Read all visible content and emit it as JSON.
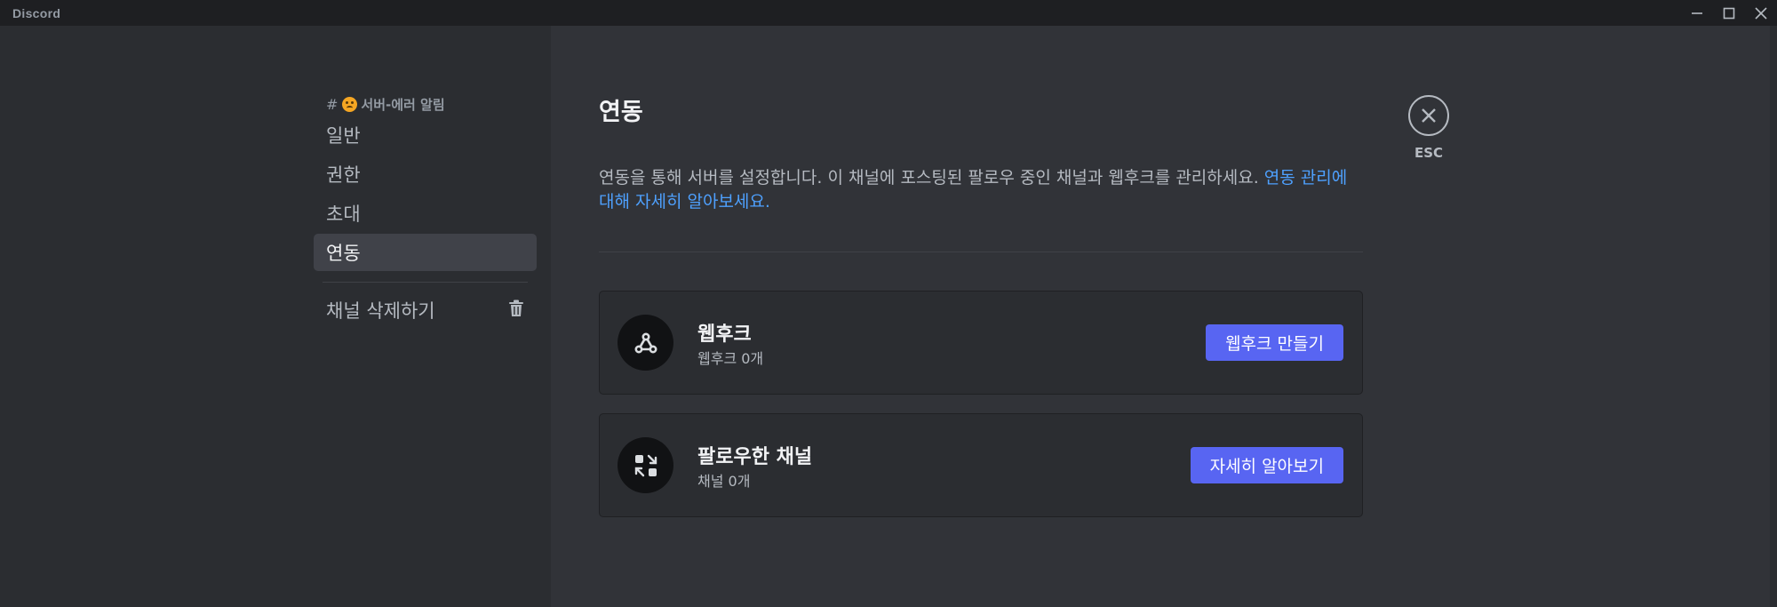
{
  "window": {
    "title": "Discord",
    "controls": [
      "minimize-icon",
      "maximize-icon",
      "close-icon"
    ]
  },
  "sidebar": {
    "channel_header": "서버-에러 알림",
    "channel_prefix": "#",
    "channel_emoji": "face-emoji-icon",
    "items": [
      {
        "label": "일반",
        "selected": false
      },
      {
        "label": "권한",
        "selected": false
      },
      {
        "label": "초대",
        "selected": false
      },
      {
        "label": "연동",
        "selected": true
      }
    ],
    "delete_label": "채널 삭제하기",
    "delete_icon": "trash-icon"
  },
  "main": {
    "title": "연동",
    "description": "연동을 통해 서버를 설정합니다. 이 채널에 포스팅된 팔로우 중인 채널과 웹후크를 관리하세요. ",
    "description_link": "연동 관리에 대해 자세히 알아보세요.",
    "cards": [
      {
        "icon": "webhook-icon",
        "title": "웹후크",
        "subtitle": "웹후크 0개",
        "button": "웹후크 만들기"
      },
      {
        "icon": "followed-channel-icon",
        "title": "팔로우한 채널",
        "subtitle": "채널 0개",
        "button": "자세히 알아보기"
      }
    ]
  },
  "esc": {
    "label": "ESC",
    "icon": "close-icon"
  },
  "colors": {
    "background": "#313338",
    "sidebar": "#2b2d31",
    "titlebar": "#1e1f22",
    "accent": "#5865f2",
    "link": "#4ea1ff",
    "selected": "#404249"
  }
}
